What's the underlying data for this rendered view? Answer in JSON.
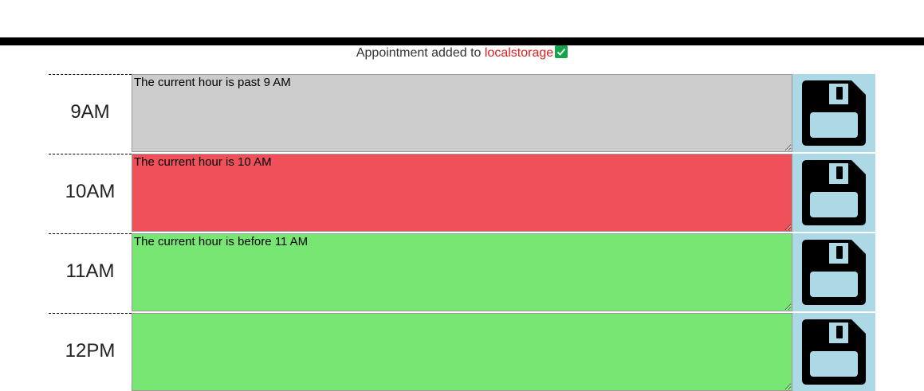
{
  "notice": {
    "prefix": "Appointment added to",
    "storage": "localstorage",
    "icon": "check-icon"
  },
  "colors": {
    "past": "#cccccc",
    "present": "#f0505a",
    "future": "#77e672",
    "save": "#add8e6",
    "notice_highlight": "#e11d1d",
    "check": "#16a34a"
  },
  "rows": [
    {
      "hour": "9AM",
      "text": "The current hour is past 9 AM",
      "status": "past",
      "icon": "save-icon"
    },
    {
      "hour": "10AM",
      "text": "The current hour is 10 AM",
      "status": "present",
      "icon": "save-icon"
    },
    {
      "hour": "11AM",
      "text": "The current hour is before 11 AM",
      "status": "future",
      "icon": "save-icon"
    },
    {
      "hour": "12PM",
      "text": "",
      "status": "future",
      "icon": "save-icon"
    }
  ]
}
